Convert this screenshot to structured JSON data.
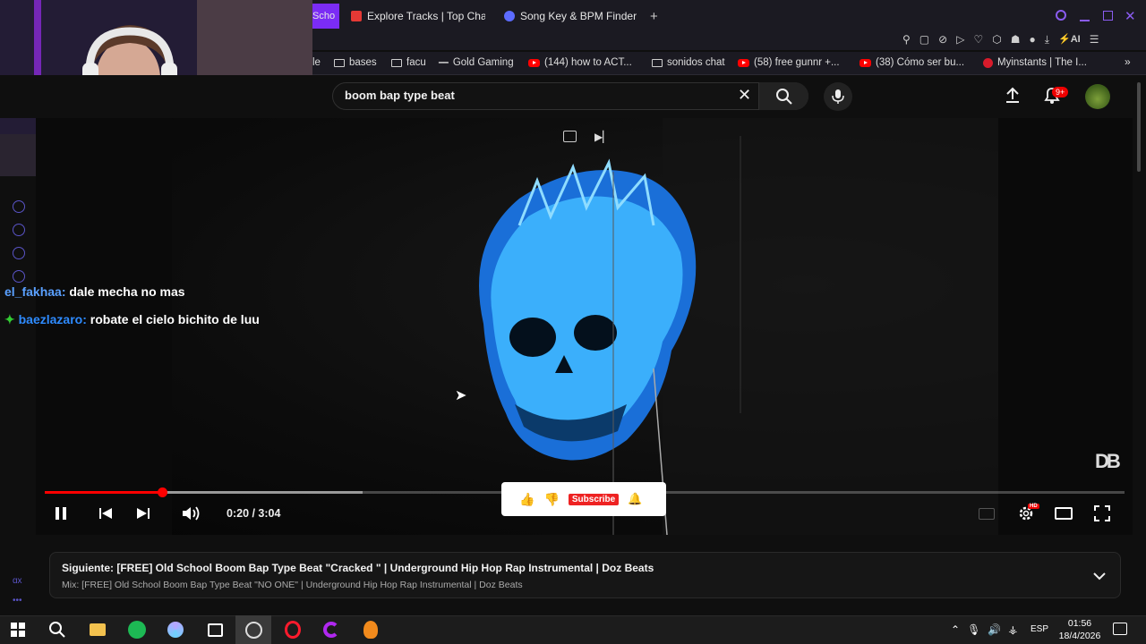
{
  "browser": {
    "tabs": [
      {
        "label": "Scho",
        "active": true
      },
      {
        "label": "Explore Tracks | Top Char",
        "active": false
      },
      {
        "label": "Song Key & BPM Finder | T",
        "active": false
      }
    ],
    "bookmarks": [
      {
        "label": "le",
        "icon": "partial"
      },
      {
        "label": "bases",
        "icon": "folder-icon"
      },
      {
        "label": "facu",
        "icon": "folder-icon"
      },
      {
        "label": "Gold Gaming",
        "icon": "gold-gaming-icon"
      },
      {
        "label": "(144) how to ACT...",
        "icon": "youtube-icon"
      },
      {
        "label": "sonidos chat",
        "icon": "folder-icon"
      },
      {
        "label": "(58) free gunnr +...",
        "icon": "youtube-icon"
      },
      {
        "label": "(38) Cómo ser bu...",
        "icon": "youtube-icon"
      },
      {
        "label": "Myinstants | The I...",
        "icon": "myinstants-icon"
      }
    ],
    "ai_label": "AI"
  },
  "youtube": {
    "search_query": "boom bap type beat",
    "notifications_badge": "9+"
  },
  "chat": {
    "messages": [
      {
        "user": "el_fakhaa:",
        "text": "dale mecha no mas"
      },
      {
        "user": "baezlazaro:",
        "text": "robate el cielo bichito de luu"
      }
    ]
  },
  "player": {
    "current_time": "0:20",
    "duration": "3:04",
    "time_display": "0:20 / 3:04",
    "played_fraction": 0.109,
    "buffered_fraction": 0.294,
    "subscribe_label": "Subscribe",
    "settings_badge": "HD",
    "watermark": "DB"
  },
  "up_next": {
    "title": "Siguiente: [FREE] Old School Boom Bap Type Beat \"Cracked \" | Underground Hip Hop Rap Instrumental | Doz Beats",
    "mix": "Mix: [FREE] Old School Boom Bap Type Beat \"NO ONE\" | Underground Hip Hop Rap Instrumental | Doz Beats"
  },
  "taskbar": {
    "lang": "ESP",
    "time": "01:56",
    "date": "18/4/2026"
  },
  "colors": {
    "accent_red": "#ff0000",
    "chat_user_blue": "#5aa0ff",
    "skull_blue": "#3fb6ff"
  }
}
